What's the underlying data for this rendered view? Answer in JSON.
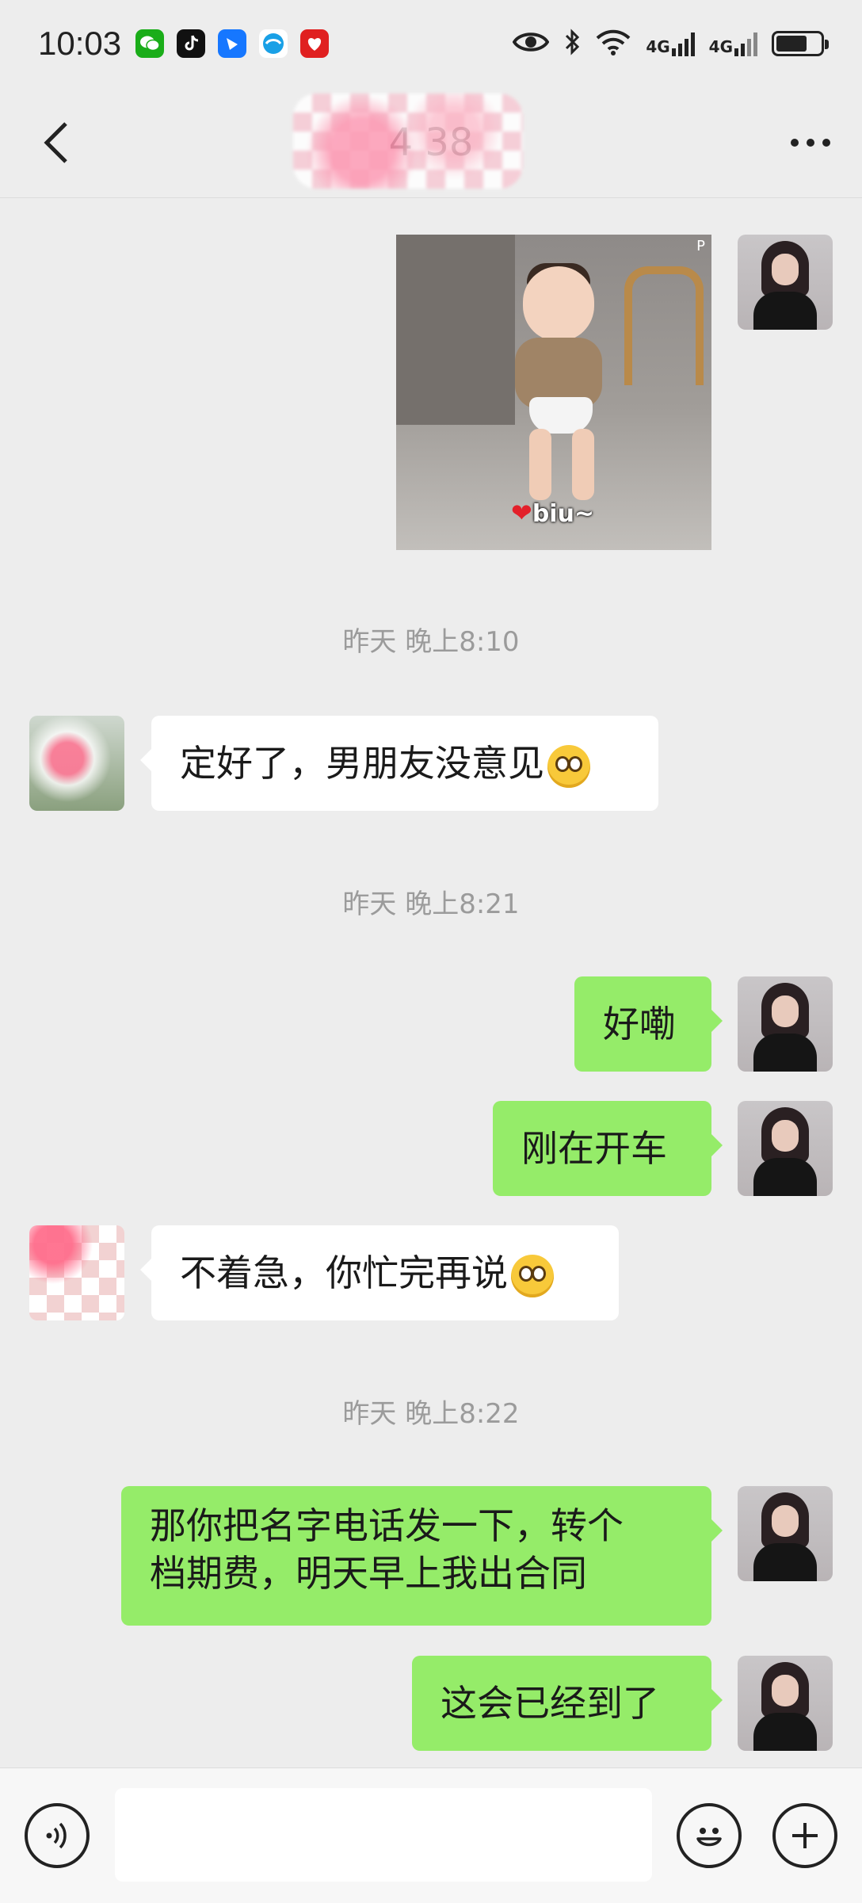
{
  "status_bar": {
    "time": "10:03",
    "network_1": "4G",
    "network_2": "4G",
    "notification_icons": [
      "wechat-icon",
      "tiktok-icon",
      "feishu-icon",
      "browser-icon",
      "app-icon"
    ]
  },
  "header": {
    "title": "4 38"
  },
  "messages": [
    {
      "type": "image",
      "from": "self",
      "caption": "biu~",
      "watermark": "P"
    },
    {
      "type": "timestamp",
      "text": "昨天 晚上8:10"
    },
    {
      "type": "text",
      "from": "other",
      "text": "定好了，男朋友没意见",
      "emoji": "pleading-face"
    },
    {
      "type": "timestamp",
      "text": "昨天 晚上8:21"
    },
    {
      "type": "text",
      "from": "self",
      "text": "好嘞"
    },
    {
      "type": "text",
      "from": "self",
      "text": "刚在开车"
    },
    {
      "type": "text",
      "from": "other",
      "text": "不着急，你忙完再说",
      "emoji": "pleading-face"
    },
    {
      "type": "timestamp",
      "text": "昨天 晚上8:22"
    },
    {
      "type": "text",
      "from": "self",
      "text_line1": "那你把名字电话发一下，转个",
      "text_line2": "档期费，明天早上我出合同"
    },
    {
      "type": "text",
      "from": "self",
      "text": "这会已经到了"
    }
  ],
  "input_bar": {
    "value": "",
    "placeholder": ""
  },
  "colors": {
    "background": "#ededed",
    "outgoing_bubble": "#95ec69",
    "incoming_bubble": "#ffffff",
    "timestamp": "#9b9b9b"
  }
}
